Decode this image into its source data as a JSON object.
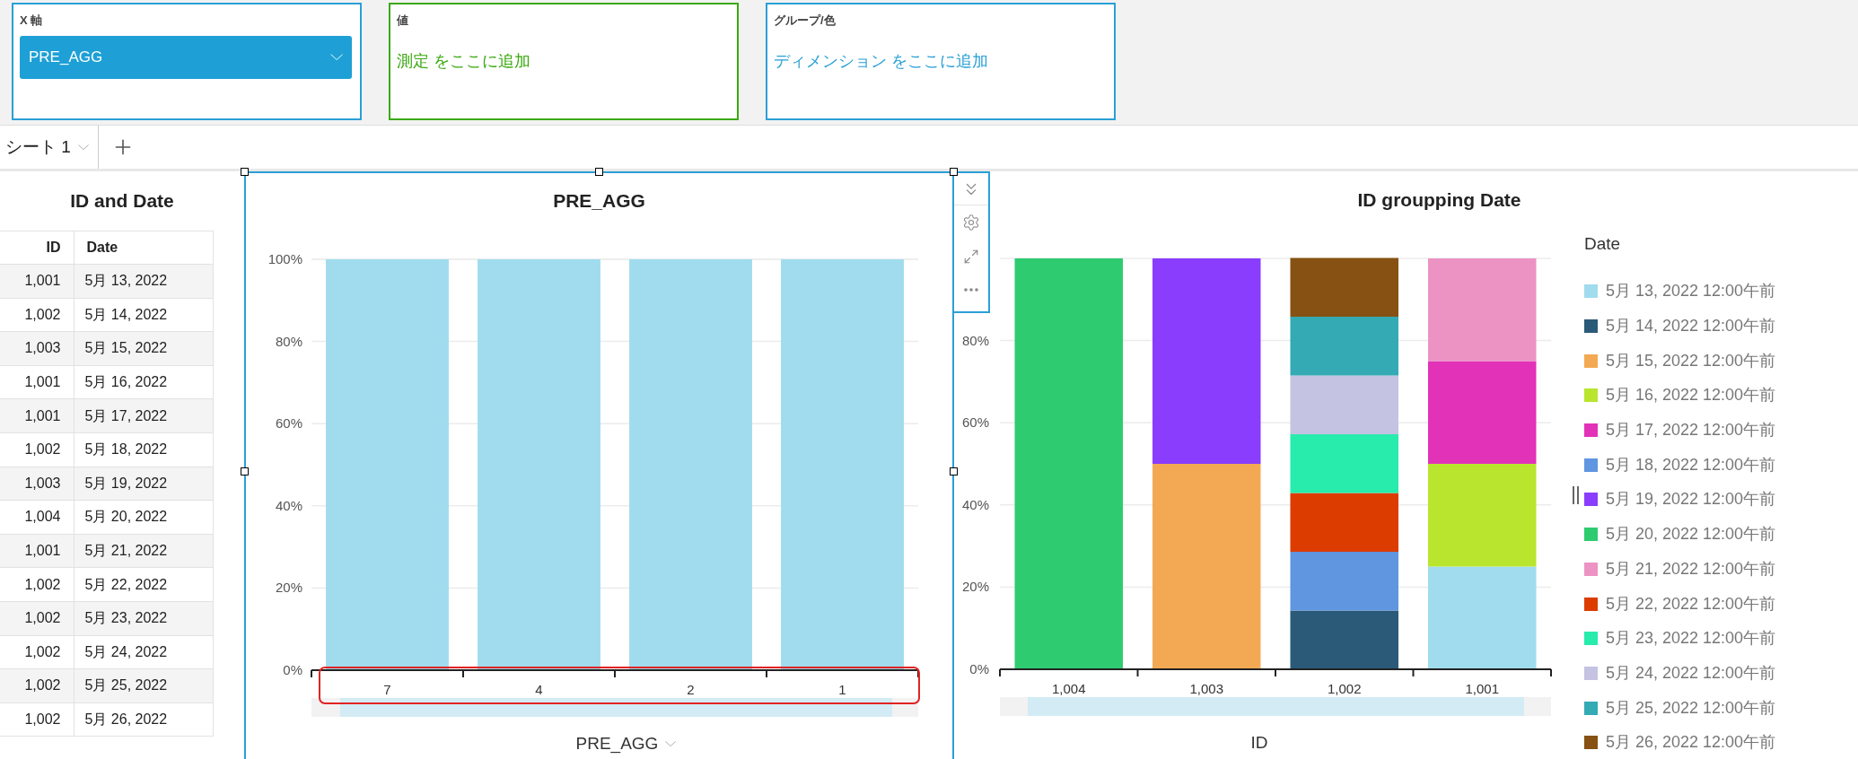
{
  "field_wells": [
    {
      "label": "X 軸",
      "kind": "dropdown",
      "value": "PRE_AGG",
      "color": "#2a9fd6"
    },
    {
      "label": "値",
      "kind": "drop_target",
      "hint": "測定 をここに追加",
      "color": "#3aa90f"
    },
    {
      "label": "グループ/色",
      "kind": "drop_target",
      "hint": "ディメンション をここに追加",
      "color": "#2a9fd6"
    }
  ],
  "sheet_tabs": [
    {
      "label": "シート 1",
      "selected": true
    }
  ],
  "visuals": [
    {
      "title": "ID and Date",
      "columns": [
        "ID",
        "Date"
      ],
      "rows": [
        [
          "1,001",
          "5月 13, 2022"
        ],
        [
          "1,002",
          "5月 14, 2022"
        ],
        [
          "1,003",
          "5月 15, 2022"
        ],
        [
          "1,001",
          "5月 16, 2022"
        ],
        [
          "1,001",
          "5月 17, 2022"
        ],
        [
          "1,002",
          "5月 18, 2022"
        ],
        [
          "1,003",
          "5月 19, 2022"
        ],
        [
          "1,004",
          "5月 20, 2022"
        ],
        [
          "1,001",
          "5月 21, 2022"
        ],
        [
          "1,002",
          "5月 22, 2022"
        ],
        [
          "1,002",
          "5月 23, 2022"
        ],
        [
          "1,002",
          "5月 24, 2022"
        ],
        [
          "1,002",
          "5月 25, 2022"
        ],
        [
          "1,002",
          "5月 26, 2022"
        ]
      ]
    },
    {
      "selected": true,
      "x_axis_label": "PRE_AGG",
      "chart_data": {
        "type": "bar",
        "title": "PRE_AGG",
        "categories": [
          "7",
          "4",
          "2",
          "1"
        ],
        "stacked": true,
        "grid": true,
        "ylim": [
          0,
          100
        ],
        "yticks": [
          {
            "value": 0,
            "label": "0%"
          },
          {
            "value": 20,
            "label": "20%"
          },
          {
            "value": 40,
            "label": "40%"
          },
          {
            "value": 60,
            "label": "60%"
          },
          {
            "value": 80,
            "label": "80%"
          },
          {
            "value": 100,
            "label": "100%"
          }
        ],
        "series": [
          {
            "color": "#a0dcee",
            "values": [
              100,
              100,
              100,
              100
            ]
          }
        ]
      }
    },
    {
      "x_axis_label": "ID",
      "legend_title": "Date",
      "chart_data": {
        "type": "bar",
        "title": "ID groupping Date",
        "categories": [
          "1,004",
          "1,003",
          "1,002",
          "1,001"
        ],
        "stacked": true,
        "grid": true,
        "ylim": [
          0,
          100
        ],
        "yticks": [
          {
            "value": 0,
            "label": "0%"
          },
          {
            "value": 20,
            "label": "20%"
          },
          {
            "value": 40,
            "label": "40%"
          },
          {
            "value": 60,
            "label": "60%"
          },
          {
            "value": 80,
            "label": "80%"
          }
        ],
        "series": [
          {
            "name": "5月 13, 2022 12:00午前",
            "color": "#a0dcee",
            "values": [
              0,
              0,
              0,
              25
            ]
          },
          {
            "name": "5月 14, 2022 12:00午前",
            "color": "#2a5a78",
            "values": [
              0,
              0,
              14.3,
              0
            ]
          },
          {
            "name": "5月 15, 2022 12:00午前",
            "color": "#f3a953",
            "values": [
              0,
              50,
              0,
              0
            ]
          },
          {
            "name": "5月 16, 2022 12:00午前",
            "color": "#b9e52f",
            "values": [
              0,
              0,
              0,
              25
            ]
          },
          {
            "name": "5月 17, 2022 12:00午前",
            "color": "#e232b8",
            "values": [
              0,
              0,
              0,
              25
            ]
          },
          {
            "name": "5月 18, 2022 12:00午前",
            "color": "#6095e0",
            "values": [
              0,
              0,
              14.3,
              0
            ]
          },
          {
            "name": "5月 19, 2022 12:00午前",
            "color": "#8a3dfd",
            "values": [
              0,
              50,
              0,
              0
            ]
          },
          {
            "name": "5月 20, 2022 12:00午前",
            "color": "#2fcb70",
            "values": [
              100,
              0,
              0,
              0
            ]
          },
          {
            "name": "5月 21, 2022 12:00午前",
            "color": "#ec93c4",
            "values": [
              0,
              0,
              0,
              25
            ]
          },
          {
            "name": "5月 22, 2022 12:00午前",
            "color": "#dc3c00",
            "values": [
              0,
              0,
              14.3,
              0
            ]
          },
          {
            "name": "5月 23, 2022 12:00午前",
            "color": "#27ecab",
            "values": [
              0,
              0,
              14.3,
              0
            ]
          },
          {
            "name": "5月 24, 2022 12:00午前",
            "color": "#c4c3e2",
            "values": [
              0,
              0,
              14.3,
              0
            ]
          },
          {
            "name": "5月 25, 2022 12:00午前",
            "color": "#33aab4",
            "values": [
              0,
              0,
              14.3,
              0
            ]
          },
          {
            "name": "5月 26, 2022 12:00午前",
            "color": "#865112",
            "values": [
              0,
              0,
              14.3,
              0
            ]
          }
        ]
      }
    }
  ]
}
